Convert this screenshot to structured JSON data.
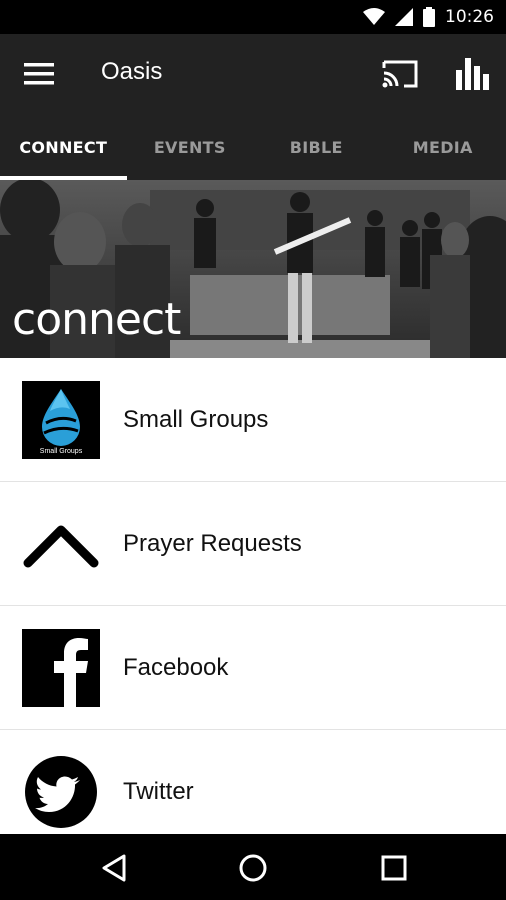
{
  "status": {
    "time": "10:26"
  },
  "app": {
    "title": "Oasis"
  },
  "tabs": [
    {
      "label": "CONNECT",
      "active": true
    },
    {
      "label": "EVENTS",
      "active": false
    },
    {
      "label": "BIBLE",
      "active": false
    },
    {
      "label": "MEDIA",
      "active": false
    }
  ],
  "hero": {
    "text": "connect"
  },
  "items": [
    {
      "label": "Small Groups",
      "thumb_text": "Small Groups",
      "icon": "water-drop-icon"
    },
    {
      "label": "Prayer Requests",
      "icon": "chevron-up-icon"
    },
    {
      "label": "Facebook",
      "icon": "facebook-icon"
    },
    {
      "label": "Twitter",
      "icon": "twitter-icon"
    }
  ],
  "colors": {
    "app_bar": "#222222",
    "status_bar": "#000000",
    "accent": "#ffffff",
    "drop": "#2a9fd8"
  }
}
